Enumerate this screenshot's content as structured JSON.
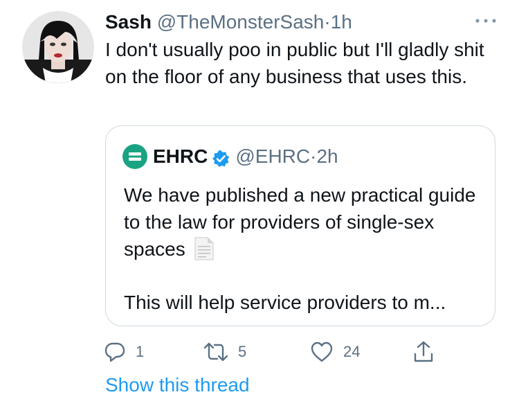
{
  "tweet": {
    "author_name": "Sash",
    "author_handle": "@TheMonsterSash",
    "separator": "·",
    "time": "1h",
    "text": "I don't usually poo in public but I'll gladly shit on the floor of any business that uses this.",
    "avatar_icon": "profile-photo"
  },
  "quoted": {
    "author_name": "EHRC",
    "author_handle": "@EHRC",
    "separator": "·",
    "time": "2h",
    "verified": true,
    "text_line1": "We have published a new practical guide to the law for providers of single-sex spaces",
    "text_line2": "This will help service providers to m...",
    "logo_color": "#1aa383",
    "doc_icon": "page-facing-up-icon"
  },
  "actions": {
    "reply_count": "1",
    "retweet_count": "5",
    "like_count": "24"
  },
  "show_thread_label": "Show this thread",
  "colors": {
    "accent": "#1d9bf0",
    "secondary_text": "#5b7083",
    "border": "#cfd9de",
    "verified": "#1d9bf0"
  }
}
